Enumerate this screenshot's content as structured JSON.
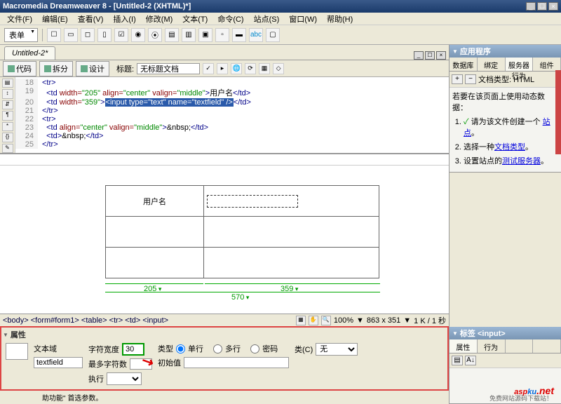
{
  "titlebar": {
    "title": "Macromedia Dreamweaver 8 - [Untitled-2 (XHTML)*]",
    "min": "_",
    "max": "☐",
    "close": "×"
  },
  "menu": {
    "file": "文件(F)",
    "edit": "编辑(E)",
    "view": "查看(V)",
    "insert": "插入(I)",
    "modify": "修改(M)",
    "text": "文本(T)",
    "commands": "命令(C)",
    "site": "站点(S)",
    "window": "窗口(W)",
    "help": "帮助(H)"
  },
  "toolbar1": {
    "dropdown": "表单"
  },
  "doc": {
    "tab": "Untitled-2*",
    "min": "_",
    "max": "☐",
    "close": "×"
  },
  "viewbar": {
    "code": "代码",
    "split": "拆分",
    "design": "设计",
    "title_label": "标题:",
    "title_value": "无标题文档"
  },
  "code": {
    "lines": [
      {
        "n": 18,
        "html": "<span class='tag'>&lt;tr&gt;</span>"
      },
      {
        "n": 19,
        "html": "  <span class='tag'>&lt;td</span> <span class='attr'>width=</span><span class='val'>\"205\"</span> <span class='attr'>align=</span><span class='val'>\"center\"</span> <span class='attr'>valign=</span><span class='val'>\"middle\"</span><span class='tag'>&gt;</span>用户名<span class='tag'>&lt;/td&gt;</span>"
      },
      {
        "n": 20,
        "html": "  <span class='tag'>&lt;td</span> <span class='attr'>width=</span><span class='val'>\"359\"</span><span class='tag'>&gt;</span><span class='sel'>&lt;input type=\"text\" name=\"textfield\" /&gt;</span><span class='tag'>&lt;/td&gt;</span>"
      },
      {
        "n": 21,
        "html": "<span class='tag'>&lt;/tr&gt;</span>"
      },
      {
        "n": 22,
        "html": "<span class='tag'>&lt;tr&gt;</span>"
      },
      {
        "n": 23,
        "html": "  <span class='tag'>&lt;td</span> <span class='attr'>align=</span><span class='val'>\"center\"</span> <span class='attr'>valign=</span><span class='val'>\"middle\"</span><span class='tag'>&gt;</span>&amp;nbsp;<span class='tag'>&lt;/td&gt;</span>"
      },
      {
        "n": 24,
        "html": "  <span class='tag'>&lt;td&gt;</span>&amp;nbsp;<span class='tag'>&lt;/td&gt;</span>"
      },
      {
        "n": 25,
        "html": "<span class='tag'>&lt;/tr&gt;</span>"
      }
    ]
  },
  "design": {
    "cell_label": "用户名",
    "dim1": "205",
    "dim2": "359",
    "dim_total": "570"
  },
  "status": {
    "path": "<body> <form#form1> <table> <tr> <td> <input>",
    "zoom": "100%",
    "dims": "863 x 351",
    "size": "1 K / 1 秒"
  },
  "props": {
    "header": "属性",
    "type_label": "文本域",
    "name_value": "textfield",
    "charwidth_label": "字符宽度",
    "charwidth_value": "30",
    "maxchars_label": "最多字符数",
    "type_group_label": "类型",
    "type_single": "单行",
    "type_multi": "多行",
    "type_pwd": "密码",
    "class_label": "类(C)",
    "class_value": "无",
    "initval_label": "初始值",
    "wrap_label": "执行"
  },
  "right": {
    "app_header": "应用程序",
    "tabs": {
      "db": "数据库",
      "bind": "绑定",
      "server": "服务器行为",
      "comp": "组件"
    },
    "doctype_label": "文档类型: HTML",
    "hint_title": "若要在该页面上使用动态数据：",
    "hint1": "请为该文件创建一个 ",
    "hint1_link": "站点",
    "hint1_suffix": "。",
    "hint2": "选择一种",
    "hint2_link": "文档类型",
    "hint2_suffix": "。",
    "hint3": "设置站点的",
    "hint3_link": "测试服务器",
    "hint3_suffix": "。",
    "tag_header": "标签 <input>",
    "tag_tab1": "属性",
    "tag_tab2": "行为"
  },
  "watermark": {
    "asp": "asp",
    "ku": "ku",
    "dot": ".net",
    "sub": "免费网站源码下载站！"
  },
  "bottom_snippet": "助功能\" 首选参数。"
}
